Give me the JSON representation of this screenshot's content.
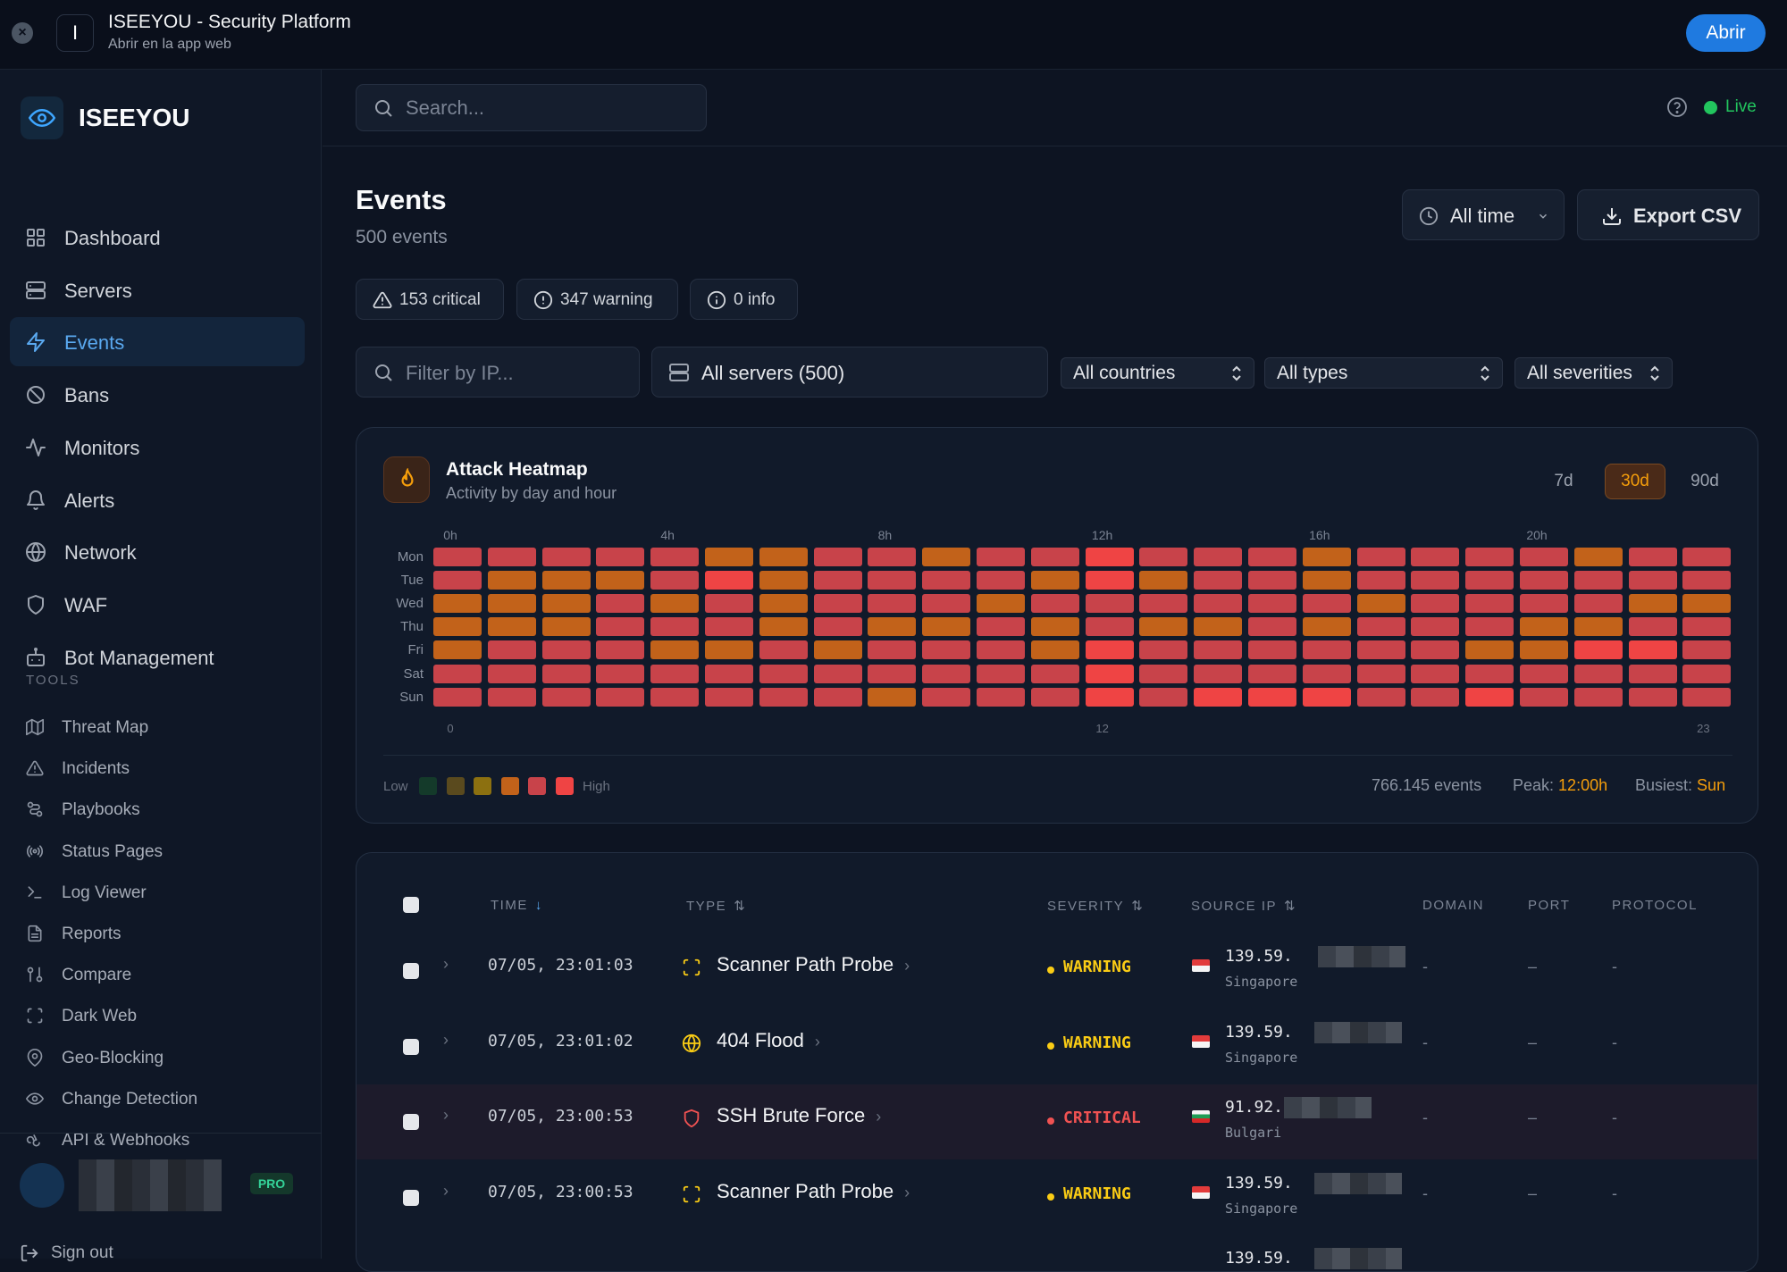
{
  "window": {
    "title": "ISEEYOU - Security Platform",
    "subtitle": "Abrir en la app web",
    "app_letter": "I",
    "open_button": "Abrir"
  },
  "sidebar": {
    "brand": "ISEEYOU",
    "items": [
      {
        "label": "Dashboard",
        "icon": "dashboard-icon"
      },
      {
        "label": "Servers",
        "icon": "server-icon"
      },
      {
        "label": "Events",
        "icon": "bolt-icon",
        "active": true
      },
      {
        "label": "Bans",
        "icon": "ban-icon"
      },
      {
        "label": "Monitors",
        "icon": "activity-icon"
      },
      {
        "label": "Alerts",
        "icon": "bell-icon"
      },
      {
        "label": "Network",
        "icon": "globe-icon"
      },
      {
        "label": "WAF",
        "icon": "shield-icon"
      },
      {
        "label": "Bot Management",
        "icon": "bot-icon"
      }
    ],
    "tools_heading": "TOOLS",
    "tools": [
      {
        "label": "Threat Map",
        "icon": "map-icon"
      },
      {
        "label": "Incidents",
        "icon": "warning-icon"
      },
      {
        "label": "Playbooks",
        "icon": "workflow-icon"
      },
      {
        "label": "Status Pages",
        "icon": "broadcast-icon"
      },
      {
        "label": "Log Viewer",
        "icon": "terminal-icon"
      },
      {
        "label": "Reports",
        "icon": "file-icon"
      },
      {
        "label": "Compare",
        "icon": "compare-icon"
      },
      {
        "label": "Dark Web",
        "icon": "scan-icon"
      },
      {
        "label": "Geo-Blocking",
        "icon": "pin-icon"
      },
      {
        "label": "Change Detection",
        "icon": "eye-icon"
      },
      {
        "label": "API & Webhooks",
        "icon": "webhook-icon"
      }
    ],
    "plan_badge": "PRO",
    "sign_out": "Sign out"
  },
  "header": {
    "search_placeholder": "Search...",
    "status": "Live"
  },
  "page": {
    "title": "Events",
    "count_label": "500 events",
    "time_filter": "All time",
    "export_label": "Export CSV",
    "chips": [
      {
        "label": "153 critical",
        "icon": "warning-icon"
      },
      {
        "label": "347 warning",
        "icon": "alert-circle-icon"
      },
      {
        "label": "0 info",
        "icon": "info-icon"
      }
    ],
    "filters": {
      "ip_placeholder": "Filter by IP...",
      "servers": "All servers (500)",
      "countries": "All countries",
      "types": "All types",
      "severities": "All severities"
    }
  },
  "heatmap": {
    "title": "Attack Heatmap",
    "subtitle": "Activity by day and hour",
    "ranges": [
      "7d",
      "30d",
      "90d"
    ],
    "active_range": "30d",
    "hour_labels": [
      "0h",
      "4h",
      "8h",
      "12h",
      "16h",
      "20h"
    ],
    "axis_labels": [
      "0",
      "12",
      "23"
    ],
    "days": [
      "Mon",
      "Tue",
      "Wed",
      "Thu",
      "Fri",
      "Sat",
      "Sun"
    ],
    "levels": [
      [
        4,
        4,
        4,
        4,
        4,
        3,
        3,
        4,
        4,
        3,
        4,
        4,
        5,
        4,
        4,
        4,
        3,
        4,
        4,
        4,
        4,
        3,
        4,
        4
      ],
      [
        4,
        3,
        3,
        3,
        4,
        5,
        3,
        4,
        4,
        4,
        4,
        3,
        5,
        3,
        4,
        4,
        3,
        4,
        4,
        4,
        4,
        4,
        4,
        4
      ],
      [
        3,
        3,
        3,
        4,
        3,
        4,
        3,
        4,
        4,
        4,
        3,
        4,
        4,
        4,
        4,
        4,
        4,
        3,
        4,
        4,
        4,
        4,
        3,
        3
      ],
      [
        3,
        3,
        3,
        4,
        4,
        4,
        3,
        4,
        3,
        3,
        4,
        3,
        4,
        3,
        3,
        4,
        3,
        4,
        4,
        4,
        3,
        3,
        4,
        4
      ],
      [
        3,
        4,
        4,
        4,
        3,
        3,
        4,
        3,
        4,
        4,
        4,
        3,
        5,
        4,
        4,
        4,
        4,
        4,
        4,
        3,
        3,
        5,
        5,
        4
      ],
      [
        4,
        4,
        4,
        4,
        4,
        4,
        4,
        4,
        4,
        4,
        4,
        4,
        5,
        4,
        4,
        4,
        4,
        4,
        4,
        4,
        4,
        4,
        4,
        4
      ],
      [
        4,
        4,
        4,
        4,
        4,
        4,
        4,
        4,
        3,
        4,
        4,
        4,
        5,
        4,
        5,
        5,
        5,
        4,
        4,
        5,
        4,
        4,
        4,
        4
      ]
    ],
    "legend_low": "Low",
    "legend_high": "High",
    "legend_colors": [
      "#143a2a",
      "#5a4a1e",
      "#8c7010",
      "#c2621a",
      "#c8434a",
      "#ef4444"
    ],
    "total_events": "766.145 events",
    "peak_label": "Peak:",
    "peak_value": "12:00h",
    "busiest_label": "Busiest:",
    "busiest_value": "Sun"
  },
  "table": {
    "columns": [
      "TIME",
      "TYPE",
      "SEVERITY",
      "SOURCE IP",
      "DOMAIN",
      "PORT",
      "PROTOCOL"
    ],
    "rows": [
      {
        "time": "07/05, 23:01:03",
        "type": "Scanner Path Probe",
        "type_icon": "scan-icon",
        "severity": "WARNING",
        "ip": "139.59.",
        "country": "Singapore",
        "flag": "sg",
        "domain": "-",
        "port": "–",
        "protocol": "-"
      },
      {
        "time": "07/05, 23:01:02",
        "type": "404 Flood",
        "type_icon": "globe-icon",
        "severity": "WARNING",
        "ip": "139.59.",
        "country": "Singapore",
        "flag": "sg",
        "domain": "-",
        "port": "–",
        "protocol": "-"
      },
      {
        "time": "07/05, 23:00:53",
        "type": "SSH Brute Force",
        "type_icon": "shield-icon",
        "severity": "CRITICAL",
        "ip": "91.92.",
        "country": "Bulgari",
        "flag": "bg",
        "domain": "-",
        "port": "–",
        "protocol": "-"
      },
      {
        "time": "07/05, 23:00:53",
        "type": "Scanner Path Probe",
        "type_icon": "scan-icon",
        "severity": "WARNING",
        "ip": "139.59.",
        "country": "Singapore",
        "flag": "sg",
        "domain": "-",
        "port": "–",
        "protocol": "-"
      },
      {
        "time": "",
        "type": "",
        "type_icon": "",
        "severity": "",
        "ip": "139.59.",
        "country": "",
        "flag": "",
        "domain": "",
        "port": "",
        "protocol": ""
      }
    ],
    "colors": {
      "warning": "#facc15",
      "critical": "#f05252"
    }
  }
}
